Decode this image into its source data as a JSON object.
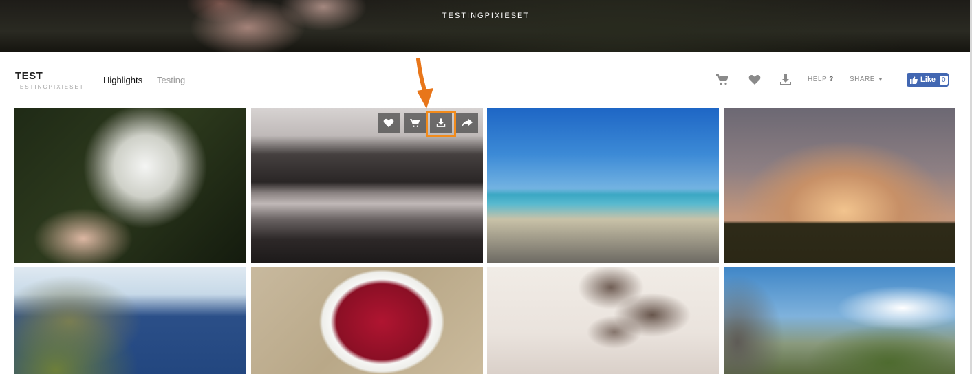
{
  "hero": {
    "title": "TESTINGPIXIESET"
  },
  "header": {
    "title": "TEST",
    "subtitle": "TESTINGPIXIESET",
    "nav": [
      {
        "label": "Highlights",
        "active": true
      },
      {
        "label": "Testing",
        "active": false
      }
    ],
    "icons": [
      "cart-icon",
      "heart-icon",
      "download-icon"
    ],
    "help_label": "HELP",
    "help_mark": "?",
    "share_label": "SHARE",
    "facebook": {
      "label": "Like",
      "count": "0"
    }
  },
  "photo_actions": [
    "heart-icon",
    "cart-icon",
    "download-icon",
    "share-icon"
  ],
  "annotation": {
    "highlight_color": "#f28b1b",
    "target": "download-icon"
  },
  "photos": [
    {
      "subject": "dandelion"
    },
    {
      "subject": "forest-lake"
    },
    {
      "subject": "vw-van-beach"
    },
    {
      "subject": "sunset-palms"
    },
    {
      "subject": "coastal-cliffs"
    },
    {
      "subject": "raspberries-cup"
    },
    {
      "subject": "palm-trees"
    },
    {
      "subject": "mountain-road"
    }
  ],
  "colors": {
    "accent": "#f28b1b",
    "facebook": "#4267b2"
  }
}
